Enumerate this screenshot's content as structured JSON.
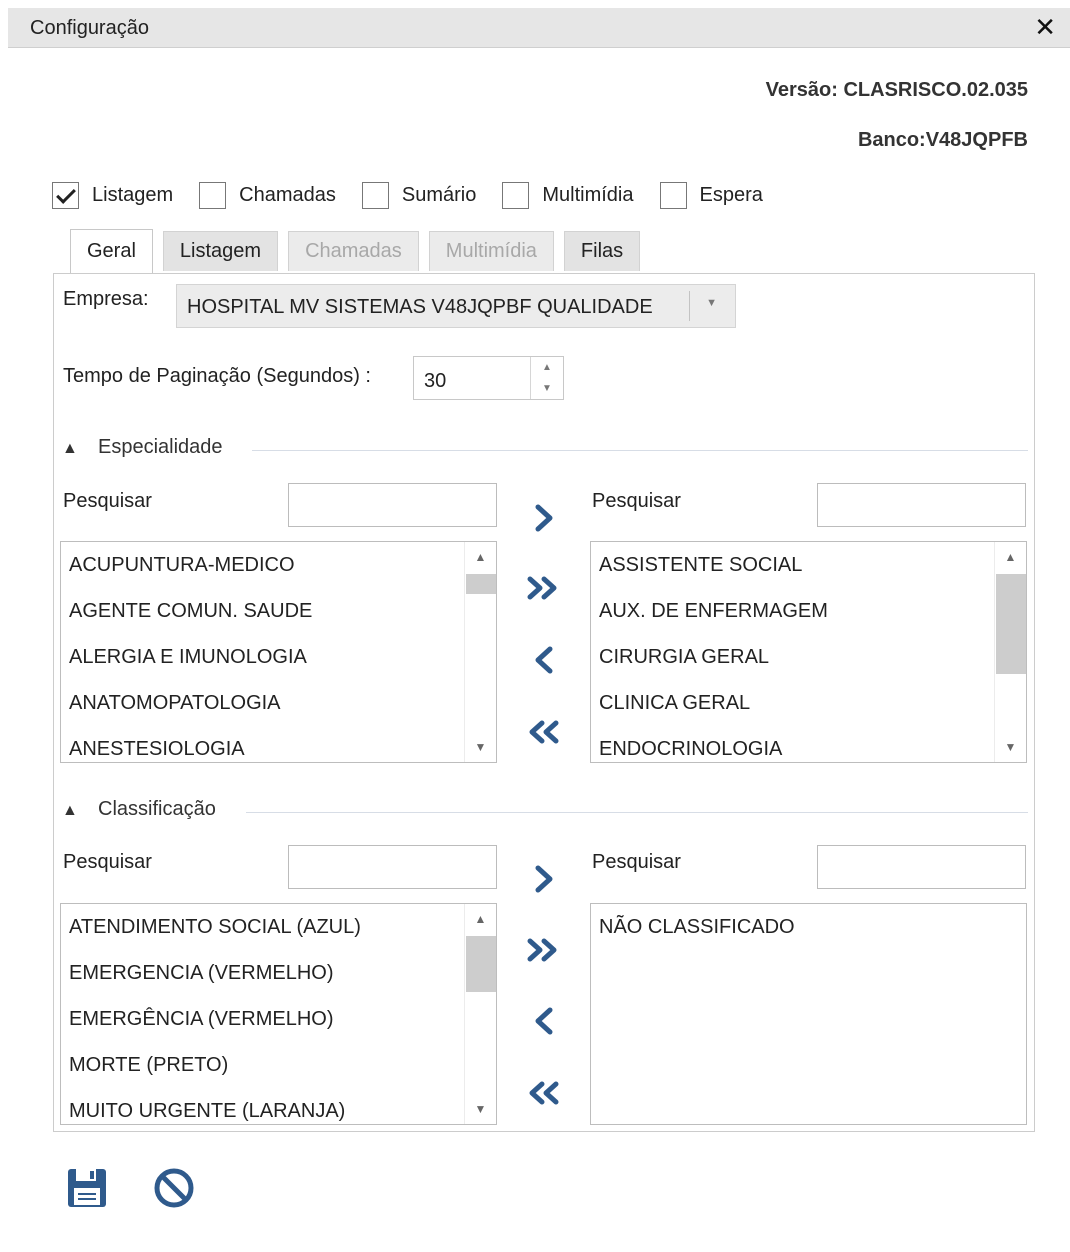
{
  "window": {
    "title": "Configuração",
    "close_icon": "close-icon"
  },
  "meta": {
    "versao": "Versão: CLASRISCO.02.035",
    "banco": "Banco:V48JQPFB"
  },
  "checkboxes": [
    {
      "label": "Listagem",
      "checked": true
    },
    {
      "label": "Chamadas",
      "checked": false
    },
    {
      "label": "Sumário",
      "checked": false
    },
    {
      "label": "Multimídia",
      "checked": false
    },
    {
      "label": "Espera",
      "checked": false
    }
  ],
  "tabs": [
    {
      "label": "Geral",
      "state": "active"
    },
    {
      "label": "Listagem",
      "state": "normal"
    },
    {
      "label": "Chamadas",
      "state": "disabled"
    },
    {
      "label": "Multimídia",
      "state": "disabled"
    },
    {
      "label": "Filas",
      "state": "normal"
    }
  ],
  "geral": {
    "empresa_label": "Empresa:",
    "empresa_value": "HOSPITAL MV SISTEMAS V48JQPBF QUALIDADE",
    "tempo_label": "Tempo de Paginação (Segundos) :",
    "tempo_value": "30"
  },
  "especialidade": {
    "title": "Especialidade",
    "search_left_label": "Pesquisar",
    "search_right_label": "Pesquisar",
    "search_left_value": "",
    "search_right_value": "",
    "available": [
      "ACUPUNTURA-MEDICO",
      "AGENTE COMUN. SAUDE",
      "ALERGIA E IMUNOLOGIA",
      "ANATOMOPATOLOGIA",
      "ANESTESIOLOGIA"
    ],
    "selected": [
      "ASSISTENTE SOCIAL",
      "AUX. DE ENFERMAGEM",
      "CIRURGIA GERAL",
      "CLINICA GERAL",
      "ENDOCRINOLOGIA"
    ]
  },
  "classificacao": {
    "title": "Classificação",
    "search_left_label": "Pesquisar",
    "search_right_label": "Pesquisar",
    "search_left_value": "",
    "search_right_value": "",
    "available": [
      "ATENDIMENTO SOCIAL (AZUL)",
      "EMERGENCIA (VERMELHO)",
      "EMERGÊNCIA (VERMELHO)",
      "MORTE (PRETO)",
      "MUITO URGENTE (LARANJA)"
    ],
    "selected": [
      "NÃO CLASSIFICADO"
    ]
  },
  "footer": {
    "save_icon": "save-icon",
    "cancel_icon": "cancel-icon"
  },
  "colors": {
    "accent": "#2f5a8c",
    "titlebar": "#e6e6e6",
    "scroll_thumb": "#cdcdcd"
  }
}
